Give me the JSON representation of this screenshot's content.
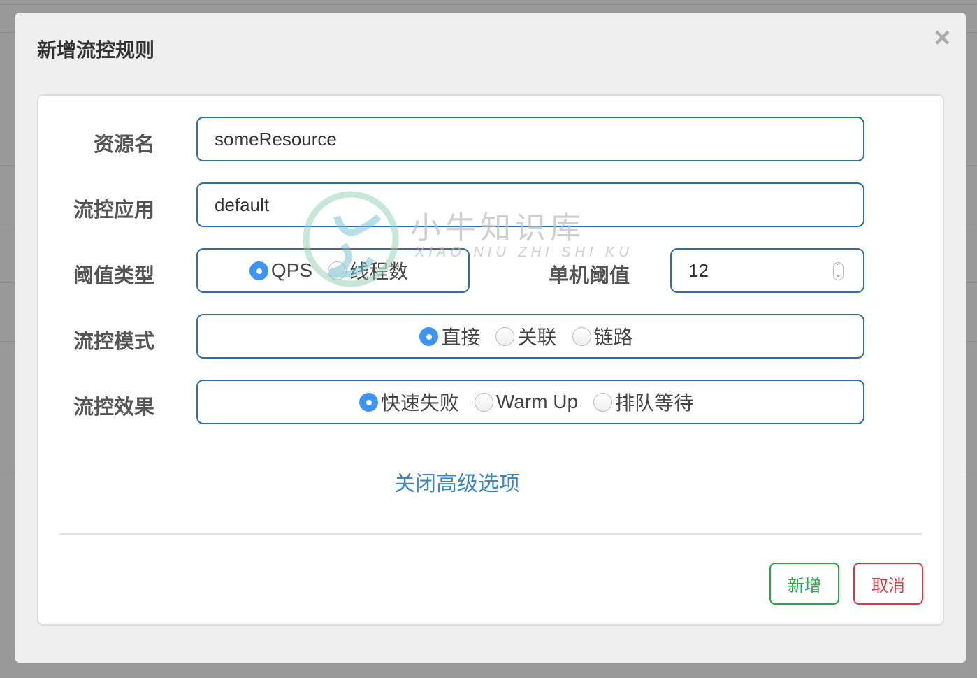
{
  "modal": {
    "title": "新增流控规则",
    "close_icon": "close-icon"
  },
  "form": {
    "resource": {
      "label": "资源名",
      "value": "someResource"
    },
    "app": {
      "label": "流控应用",
      "value": "default"
    },
    "grade": {
      "label": "阈值类型",
      "options": [
        "QPS",
        "线程数"
      ],
      "selected": "QPS"
    },
    "count": {
      "label": "单机阈值",
      "value": "12"
    },
    "strategy": {
      "label": "流控模式",
      "options": [
        "直接",
        "关联",
        "链路"
      ],
      "selected": "直接"
    },
    "behavior": {
      "label": "流控效果",
      "options": [
        "快速失败",
        "Warm Up",
        "排队等待"
      ],
      "selected": "快速失败"
    },
    "advanced_toggle": "关闭高级选项"
  },
  "buttons": {
    "add": "新增",
    "cancel": "取消"
  },
  "watermark": {
    "cn": "小牛知识库",
    "en": "XIAO NIU ZHI SHI KU"
  },
  "colors": {
    "accent": "#3d95f2",
    "link": "#3a87c8",
    "add": "#28a745",
    "cancel": "#dc3545",
    "border": "#2f6fa8"
  }
}
